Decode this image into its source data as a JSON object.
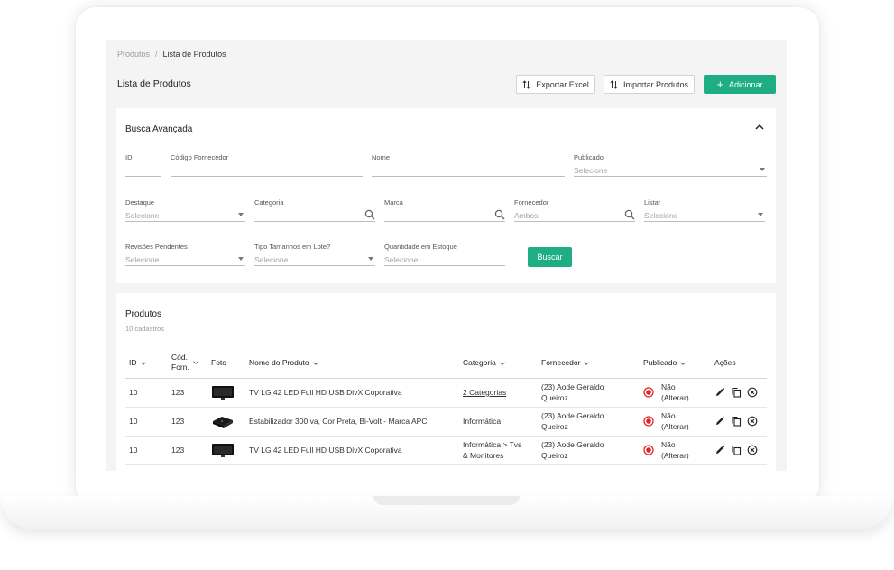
{
  "breadcrumb": {
    "root": "Produtos",
    "separator": "/",
    "current": "Lista de Produtos"
  },
  "page": {
    "title": "Lista de Produtos"
  },
  "toolbar": {
    "export_label": "Exportar Excel",
    "import_label": "Importar Produtos",
    "add_label": "Adicionar"
  },
  "search": {
    "title": "Busca Avançada",
    "fields": {
      "id": {
        "label": "ID",
        "value": ""
      },
      "supplier_code": {
        "label": "Código Fornecedor",
        "value": ""
      },
      "name": {
        "label": "Nome",
        "value": ""
      },
      "published": {
        "label": "Publicado",
        "value": "Selecione"
      },
      "featured": {
        "label": "Destaque",
        "value": "Selecione"
      },
      "category": {
        "label": "Categoria",
        "value": ""
      },
      "brand": {
        "label": "Marca",
        "value": ""
      },
      "supplier": {
        "label": "Fornecedor",
        "value": "Ambos"
      },
      "list": {
        "label": "Listar",
        "value": "Selecione"
      },
      "pending_reviews": {
        "label": "Revisões Pendentes",
        "value": "Selecione"
      },
      "batch_sizes": {
        "label": "Tipo Tamanhos em Lote?",
        "value": "Selecione"
      },
      "stock_qty": {
        "label": "Quantidade em Estoque",
        "value": "Selecione"
      }
    },
    "submit_label": "Buscar"
  },
  "products": {
    "title": "Produtos",
    "count_label": "10 cadastros",
    "columns": {
      "id": "ID",
      "code_line1": "Cód.",
      "code_line2": "Forn.",
      "photo": "Foto",
      "name": "Nome do Produto",
      "category": "Categoria",
      "supplier": "Fornecedor",
      "published": "Publicado",
      "actions": "Ações"
    },
    "rows": [
      {
        "id": "10",
        "code": "123",
        "name": "TV LG 42 LED Full HD USB DivX Coporativa",
        "category_line1": "2 Categorias",
        "category_line2": "",
        "supplier_line1": "(23) Aode Geraldo",
        "supplier_line2": "Queiroz",
        "published_line1": "Não",
        "published_line2": "(Alterar)"
      },
      {
        "id": "10",
        "code": "123",
        "name": "Estabilizador 300 va, Cor Preta, Bi-Volt - Marca APC",
        "category_line1": "Informática",
        "category_line2": "",
        "supplier_line1": "(23) Aode Geraldo",
        "supplier_line2": "Queiroz",
        "published_line1": "Não",
        "published_line2": "(Alterar)"
      },
      {
        "id": "10",
        "code": "123",
        "name": "TV LG 42 LED Full HD USB DivX Coporativa",
        "category_line1": "Informática > Tvs",
        "category_line2": "& Monitores",
        "supplier_line1": "(23) Aode Geraldo",
        "supplier_line2": "Queiroz",
        "published_line1": "Não",
        "published_line2": "(Alterar)"
      }
    ]
  },
  "colors": {
    "accent": "#1fae84",
    "status_red": "#e0262b",
    "background": "#f4f4f5"
  }
}
